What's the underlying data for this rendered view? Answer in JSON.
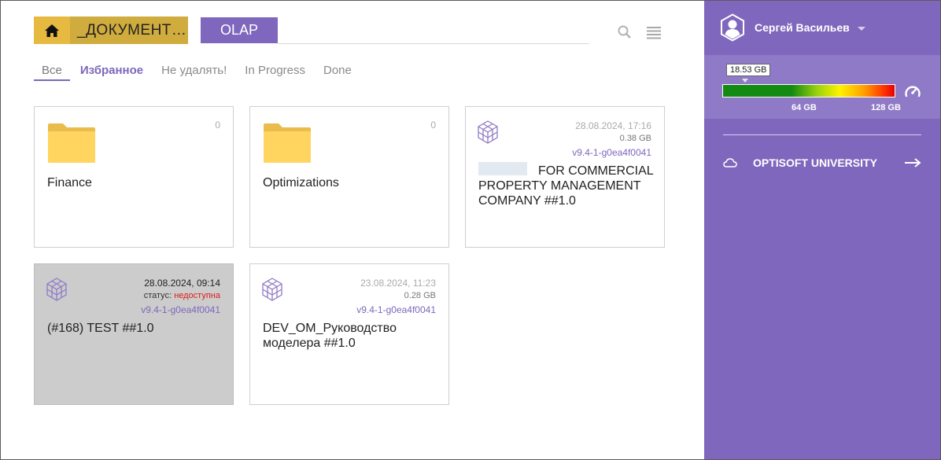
{
  "header": {
    "breadcrumb": "_ДОКУМЕНТ…",
    "olap_button": "OLAP"
  },
  "tabs": [
    {
      "label": "Все"
    },
    {
      "label": "Избранное"
    },
    {
      "label": "Не удалять!"
    },
    {
      "label": "In Progress"
    },
    {
      "label": "Done"
    }
  ],
  "cards": [
    {
      "type": "folder",
      "count": "0",
      "title": "Finance"
    },
    {
      "type": "folder",
      "count": "0",
      "title": "Optimizations"
    },
    {
      "type": "model",
      "date": "28.08.2024, 17:16",
      "size": "0.38 GB",
      "version": "v9.4-1-g0ea4f0041",
      "title": "FOR COMMERCIAL PROPERTY MANAGEMENT COMPANY ##1.0"
    },
    {
      "type": "model",
      "date": "28.08.2024, 09:14",
      "status_label": "статус:",
      "status_value": "недоступна",
      "version": "v9.4-1-g0ea4f0041",
      "title": "(#168) TEST ##1.0"
    },
    {
      "type": "model",
      "date": "23.08.2024, 11:23",
      "size": "0.28 GB",
      "version": "v9.4-1-g0ea4f0041",
      "title": "DEV_OM_Руководство моделера ##1.0"
    }
  ],
  "sidebar": {
    "user_name": "Сергей Васильев",
    "memory": {
      "used_label": "18.53 GB",
      "used_gb": 18.53,
      "marks": [
        "64 GB",
        "128 GB"
      ]
    },
    "link_label": "OPTISOFT UNIVERSITY"
  },
  "colors": {
    "accent": "#7e67bc",
    "home": "#e6b940",
    "breadcrumb": "#cfac3d",
    "folder": "#ffd45f",
    "status_red": "#e01b1b"
  }
}
